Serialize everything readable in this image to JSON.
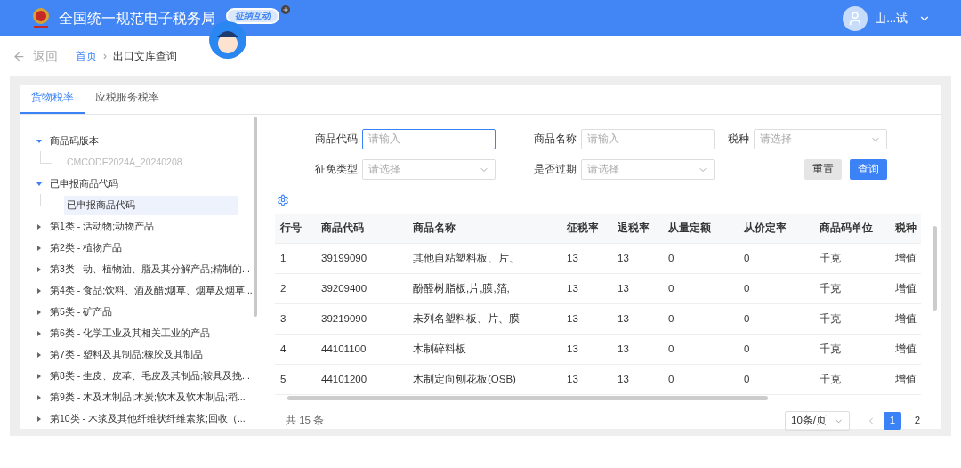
{
  "header": {
    "title": "全国统一规范电子税务局",
    "badge": "征纳互动",
    "user": "山...试"
  },
  "breadcrumb": {
    "back": "返回",
    "separator": "›",
    "items": [
      {
        "label": "首页",
        "link": true
      },
      {
        "label": "出口文库查询",
        "link": false
      }
    ]
  },
  "tabs": [
    {
      "label": "货物税率",
      "selected": true
    },
    {
      "label": "应税服务税率",
      "selected": false
    }
  ],
  "tree": [
    {
      "label": "商品码版本",
      "expanded": true,
      "children": [
        {
          "label": "CMCODE2024A_20240208",
          "disabled": true,
          "selected": false
        }
      ]
    },
    {
      "label": "已申报商品代码",
      "expanded": true,
      "children": [
        {
          "label": "已申报商品代码",
          "disabled": false,
          "selected": true
        }
      ]
    },
    {
      "label": "第1类 - 活动物;动物产品",
      "expanded": false
    },
    {
      "label": "第2类 - 植物产品",
      "expanded": false
    },
    {
      "label": "第3类 - 动、植物油、脂及其分解产品;精制的...",
      "expanded": false
    },
    {
      "label": "第4类 - 食品;饮料、酒及醋;烟草、烟草及烟草...",
      "expanded": false
    },
    {
      "label": "第5类 - 矿产品",
      "expanded": false
    },
    {
      "label": "第6类 - 化学工业及其相关工业的产品",
      "expanded": false
    },
    {
      "label": "第7类 - 塑料及其制品;橡胶及其制品",
      "expanded": false
    },
    {
      "label": "第8类 - 生皮、皮革、毛皮及其制品;鞍具及挽...",
      "expanded": false
    },
    {
      "label": "第9类 - 木及木制品;木炭;软木及软木制品;稻...",
      "expanded": false
    },
    {
      "label": "第10类 - 木浆及其他纤维状纤维素浆;回收（...",
      "expanded": false
    }
  ],
  "filters": [
    {
      "label": "商品代码",
      "kind": "input",
      "placeholder": "请输入",
      "focused": true
    },
    {
      "label": "商品名称",
      "kind": "input",
      "placeholder": "请输入",
      "focused": false
    },
    {
      "label": "税种",
      "kind": "select",
      "placeholder": "请选择",
      "focused": false
    },
    {
      "label": "征免类型",
      "kind": "select",
      "placeholder": "请选择",
      "focused": false
    },
    {
      "label": "是否过期",
      "kind": "select",
      "placeholder": "请选择",
      "focused": false
    }
  ],
  "buttons": [
    {
      "label": "重置",
      "kind": "secondary"
    },
    {
      "label": "查询",
      "kind": "primary"
    }
  ],
  "table": {
    "columns": [
      "行号",
      "商品代码",
      "商品名称",
      "征税率",
      "退税率",
      "从量定额",
      "从价定率",
      "商品码单位",
      "税种"
    ],
    "rows": [
      [
        "1",
        "39199090",
        "其他自粘塑料板、片、",
        "13",
        "13",
        "0",
        "0",
        "千克",
        "增值"
      ],
      [
        "2",
        "39209400",
        "酚醛树脂板,片,膜,箔,",
        "13",
        "13",
        "0",
        "0",
        "千克",
        "增值"
      ],
      [
        "3",
        "39219090",
        "未列名塑料板、片、膜",
        "13",
        "13",
        "0",
        "0",
        "千克",
        "增值"
      ],
      [
        "4",
        "44101100",
        "木制碎料板",
        "13",
        "13",
        "0",
        "0",
        "千克",
        "增值"
      ],
      [
        "5",
        "44101200",
        "木制定向刨花板(OSB)",
        "13",
        "13",
        "0",
        "0",
        "千克",
        "增值"
      ]
    ]
  },
  "pagination": {
    "total": "共 15 条",
    "page_size": "10条/页",
    "pages": [
      {
        "label": "1",
        "selected": true
      },
      {
        "label": "2",
        "selected": false
      }
    ]
  }
}
